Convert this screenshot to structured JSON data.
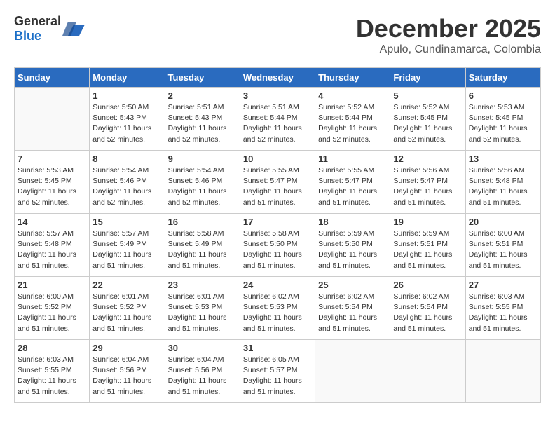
{
  "logo": {
    "general": "General",
    "blue": "Blue"
  },
  "title": "December 2025",
  "location": "Apulo, Cundinamarca, Colombia",
  "weekdays": [
    "Sunday",
    "Monday",
    "Tuesday",
    "Wednesday",
    "Thursday",
    "Friday",
    "Saturday"
  ],
  "weeks": [
    [
      {
        "day": "",
        "info": ""
      },
      {
        "day": "1",
        "info": "Sunrise: 5:50 AM\nSunset: 5:43 PM\nDaylight: 11 hours\nand 52 minutes."
      },
      {
        "day": "2",
        "info": "Sunrise: 5:51 AM\nSunset: 5:43 PM\nDaylight: 11 hours\nand 52 minutes."
      },
      {
        "day": "3",
        "info": "Sunrise: 5:51 AM\nSunset: 5:44 PM\nDaylight: 11 hours\nand 52 minutes."
      },
      {
        "day": "4",
        "info": "Sunrise: 5:52 AM\nSunset: 5:44 PM\nDaylight: 11 hours\nand 52 minutes."
      },
      {
        "day": "5",
        "info": "Sunrise: 5:52 AM\nSunset: 5:45 PM\nDaylight: 11 hours\nand 52 minutes."
      },
      {
        "day": "6",
        "info": "Sunrise: 5:53 AM\nSunset: 5:45 PM\nDaylight: 11 hours\nand 52 minutes."
      }
    ],
    [
      {
        "day": "7",
        "info": "Sunrise: 5:53 AM\nSunset: 5:45 PM\nDaylight: 11 hours\nand 52 minutes."
      },
      {
        "day": "8",
        "info": "Sunrise: 5:54 AM\nSunset: 5:46 PM\nDaylight: 11 hours\nand 52 minutes."
      },
      {
        "day": "9",
        "info": "Sunrise: 5:54 AM\nSunset: 5:46 PM\nDaylight: 11 hours\nand 52 minutes."
      },
      {
        "day": "10",
        "info": "Sunrise: 5:55 AM\nSunset: 5:47 PM\nDaylight: 11 hours\nand 51 minutes."
      },
      {
        "day": "11",
        "info": "Sunrise: 5:55 AM\nSunset: 5:47 PM\nDaylight: 11 hours\nand 51 minutes."
      },
      {
        "day": "12",
        "info": "Sunrise: 5:56 AM\nSunset: 5:47 PM\nDaylight: 11 hours\nand 51 minutes."
      },
      {
        "day": "13",
        "info": "Sunrise: 5:56 AM\nSunset: 5:48 PM\nDaylight: 11 hours\nand 51 minutes."
      }
    ],
    [
      {
        "day": "14",
        "info": "Sunrise: 5:57 AM\nSunset: 5:48 PM\nDaylight: 11 hours\nand 51 minutes."
      },
      {
        "day": "15",
        "info": "Sunrise: 5:57 AM\nSunset: 5:49 PM\nDaylight: 11 hours\nand 51 minutes."
      },
      {
        "day": "16",
        "info": "Sunrise: 5:58 AM\nSunset: 5:49 PM\nDaylight: 11 hours\nand 51 minutes."
      },
      {
        "day": "17",
        "info": "Sunrise: 5:58 AM\nSunset: 5:50 PM\nDaylight: 11 hours\nand 51 minutes."
      },
      {
        "day": "18",
        "info": "Sunrise: 5:59 AM\nSunset: 5:50 PM\nDaylight: 11 hours\nand 51 minutes."
      },
      {
        "day": "19",
        "info": "Sunrise: 5:59 AM\nSunset: 5:51 PM\nDaylight: 11 hours\nand 51 minutes."
      },
      {
        "day": "20",
        "info": "Sunrise: 6:00 AM\nSunset: 5:51 PM\nDaylight: 11 hours\nand 51 minutes."
      }
    ],
    [
      {
        "day": "21",
        "info": "Sunrise: 6:00 AM\nSunset: 5:52 PM\nDaylight: 11 hours\nand 51 minutes."
      },
      {
        "day": "22",
        "info": "Sunrise: 6:01 AM\nSunset: 5:52 PM\nDaylight: 11 hours\nand 51 minutes."
      },
      {
        "day": "23",
        "info": "Sunrise: 6:01 AM\nSunset: 5:53 PM\nDaylight: 11 hours\nand 51 minutes."
      },
      {
        "day": "24",
        "info": "Sunrise: 6:02 AM\nSunset: 5:53 PM\nDaylight: 11 hours\nand 51 minutes."
      },
      {
        "day": "25",
        "info": "Sunrise: 6:02 AM\nSunset: 5:54 PM\nDaylight: 11 hours\nand 51 minutes."
      },
      {
        "day": "26",
        "info": "Sunrise: 6:02 AM\nSunset: 5:54 PM\nDaylight: 11 hours\nand 51 minutes."
      },
      {
        "day": "27",
        "info": "Sunrise: 6:03 AM\nSunset: 5:55 PM\nDaylight: 11 hours\nand 51 minutes."
      }
    ],
    [
      {
        "day": "28",
        "info": "Sunrise: 6:03 AM\nSunset: 5:55 PM\nDaylight: 11 hours\nand 51 minutes."
      },
      {
        "day": "29",
        "info": "Sunrise: 6:04 AM\nSunset: 5:56 PM\nDaylight: 11 hours\nand 51 minutes."
      },
      {
        "day": "30",
        "info": "Sunrise: 6:04 AM\nSunset: 5:56 PM\nDaylight: 11 hours\nand 51 minutes."
      },
      {
        "day": "31",
        "info": "Sunrise: 6:05 AM\nSunset: 5:57 PM\nDaylight: 11 hours\nand 51 minutes."
      },
      {
        "day": "",
        "info": ""
      },
      {
        "day": "",
        "info": ""
      },
      {
        "day": "",
        "info": ""
      }
    ]
  ]
}
